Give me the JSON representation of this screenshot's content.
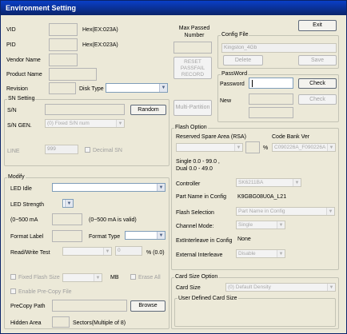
{
  "window": {
    "title": "Environment Setting"
  },
  "buttons": {
    "exit": "Exit",
    "reset": "RESET\nPASSFAIL\nRECORD",
    "multi_partition": "Multi-Partition",
    "random": "Random",
    "browse": "Browse",
    "delete": "Delete",
    "save": "Save",
    "check_password": "Check",
    "check_new": "Check"
  },
  "ids": {
    "vid_label": "VID",
    "vid_hint": "Hex(EX:023A)",
    "pid_label": "PID",
    "pid_hint": "Hex(EX:023A)",
    "vendor_name": "Vendor Name",
    "product_name": "Product Name",
    "revision": "Revision",
    "disk_type": "Disk Type",
    "max_passed_number": "Max Passed\nNumber"
  },
  "config_file": {
    "title": "Config File",
    "value": "Kingston_4Gb"
  },
  "password": {
    "title": "PassWord",
    "password_label": "Password",
    "new_label": "New"
  },
  "sn_setting": {
    "title": "SN Setting",
    "sn_label": "S/N",
    "sn_gen_label": "S/N GEN.",
    "sn_gen_value": "(0) Fixed S/N num",
    "line_label": "LINE",
    "line_value": "999",
    "decimal_sn": "Decimal SN"
  },
  "flash_option": {
    "title": "Flash Option",
    "reserved_label": "Reserved Spare Area (RSA)",
    "percent": "%",
    "code_bank_label": "Code Bank Ver",
    "code_bank_value": "C090226A_F090226A",
    "single": "Single 0.0 - 99.0 ,",
    "dual": "Dual 0.0 - 49.0",
    "controller_label": "Controller",
    "controller_value": "SK6211BA",
    "part_name_label": "Part Name in Config",
    "part_name_value": "K9GBG08U0A_L21",
    "flash_selection_label": "Flash Selection",
    "flash_selection_value": "Part Name in Config",
    "channel_mode_label": "Channel Mode:",
    "channel_mode_value": "Single",
    "ext_interleave_label": "ExtInterleave in Config",
    "ext_interleave_value": "None",
    "external_interleave_label": "External Interleave",
    "external_interleave_value": "Disable"
  },
  "modify": {
    "title": "Modify",
    "led_idle": "LED Idle",
    "led_strength": "LED Strength",
    "ma_label": "(0~500 mA",
    "ma_hint": "(0~500 mA is valid)",
    "format_label": "Format Label",
    "format_type": "Format Type",
    "read_write_test": "Read/Write Test",
    "rw_value": "0",
    "rw_percent": "% (0.0)",
    "fixed_flash_size": "Fixed Flash Size",
    "mb": "MB",
    "erase_all": "Erase All",
    "enable_precopy": "Enable Pre-Copy File",
    "precopy_path": "PreCopy Path",
    "hidden_area": "Hidden Area",
    "sectors": "Sectors(Multiple of 8)"
  },
  "card_size": {
    "title": "Card Size Option",
    "card_size_label": "Card Size",
    "card_size_value": "(0) Default Density",
    "user_defined": "User Defined Card Size"
  }
}
